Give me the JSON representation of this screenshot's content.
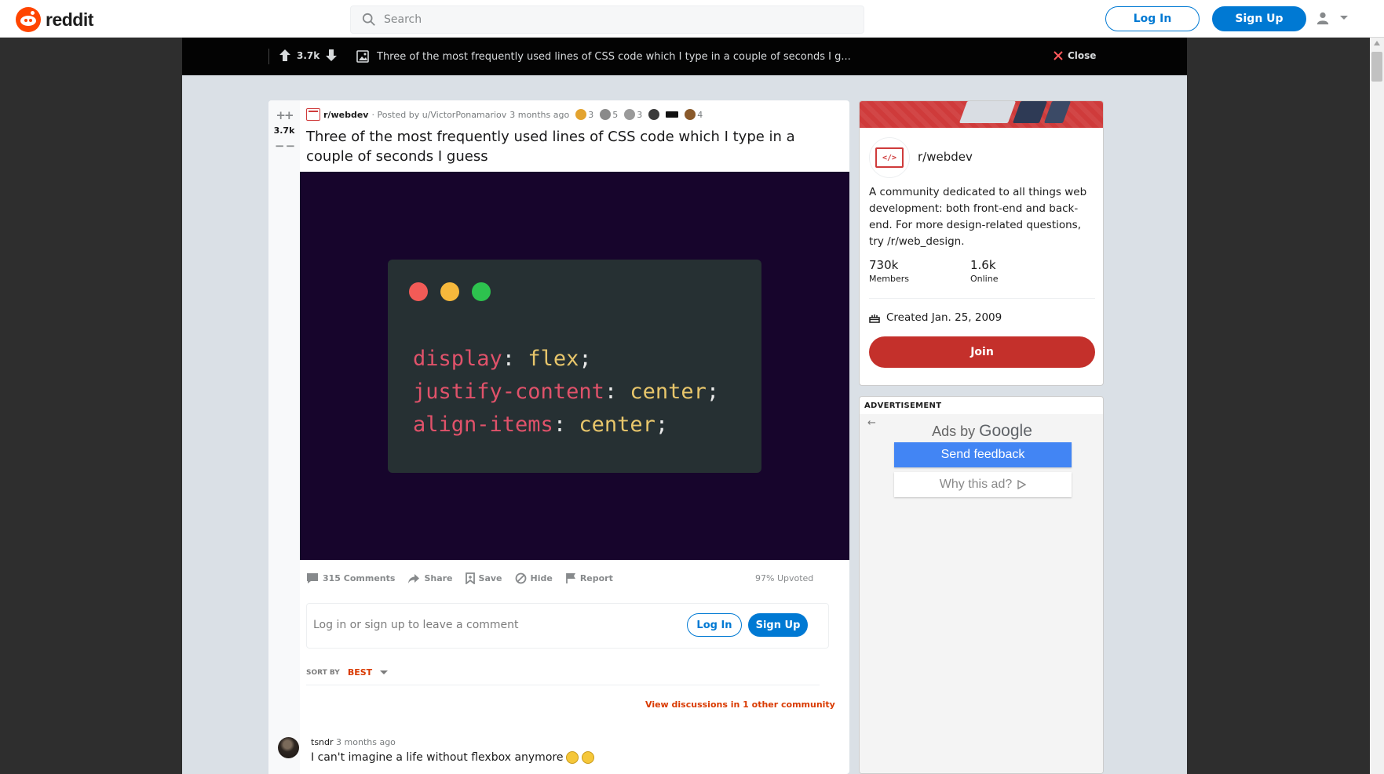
{
  "header": {
    "logo_text": "reddit",
    "search_placeholder": "Search",
    "login_label": "Log In",
    "signup_label": "Sign Up"
  },
  "post_bar": {
    "score": "3.7k",
    "title": "Three of the most frequently used lines of CSS code which I type in a couple of seconds I g...",
    "close_label": "Close"
  },
  "post": {
    "score": "3.7k",
    "subreddit": "r/webdev",
    "posted_by": "· Posted by u/VictorPonamariov",
    "time": "3 months ago",
    "awards": [
      {
        "count": "3",
        "color": "#e3a32f"
      },
      {
        "count": "5",
        "color": "#8a8a8a"
      },
      {
        "count": "3",
        "color": "#9a9a9a"
      },
      {
        "count": "",
        "color": "#3a3a3a"
      },
      {
        "count": "",
        "color": "#111111"
      },
      {
        "count": "4",
        "color": "#8a5a2b"
      }
    ],
    "title": "Three of the most frequently used lines of CSS code which I type in a couple of seconds I guess",
    "code": [
      {
        "prop": "display",
        "value": "flex"
      },
      {
        "prop": "justify-content",
        "value": "center"
      },
      {
        "prop": "align-items",
        "value": "center"
      }
    ],
    "actions": {
      "comments": "315 Comments",
      "share": "Share",
      "save": "Save",
      "hide": "Hide",
      "report": "Report"
    },
    "upvoted": "97% Upvoted",
    "comment_prompt": "Log in or sign up to leave a comment",
    "login_label": "Log In",
    "signup_label": "Sign Up",
    "sort_label": "SORT BY",
    "sort_value": "BEST",
    "view_discussions": "View discussions in 1 other community"
  },
  "comment": {
    "user": "tsndr",
    "time": "3 months ago",
    "text": "I can't imagine a life without flexbox anymore"
  },
  "sidebar": {
    "community_name": "r/webdev",
    "community_icon_text": "</>",
    "description": "A community dedicated to all things web development: both front-end and back-end. For more design-related questions, try /r/web_design.",
    "members_count": "730k",
    "members_label": "Members",
    "online_count": "1.6k",
    "online_label": "Online",
    "created": "Created Jan. 25, 2009",
    "join_label": "Join"
  },
  "ad": {
    "label": "ADVERTISEMENT",
    "ads_by_prefix": "Ads by",
    "ads_by_brand": "Google",
    "send_feedback": "Send feedback",
    "why_this_ad": "Why this ad?"
  },
  "colors": {
    "brand": "#ff4500",
    "link_blue": "#0079d3",
    "webdev_red": "#cf3b3b",
    "code_bg": "#17052c"
  }
}
